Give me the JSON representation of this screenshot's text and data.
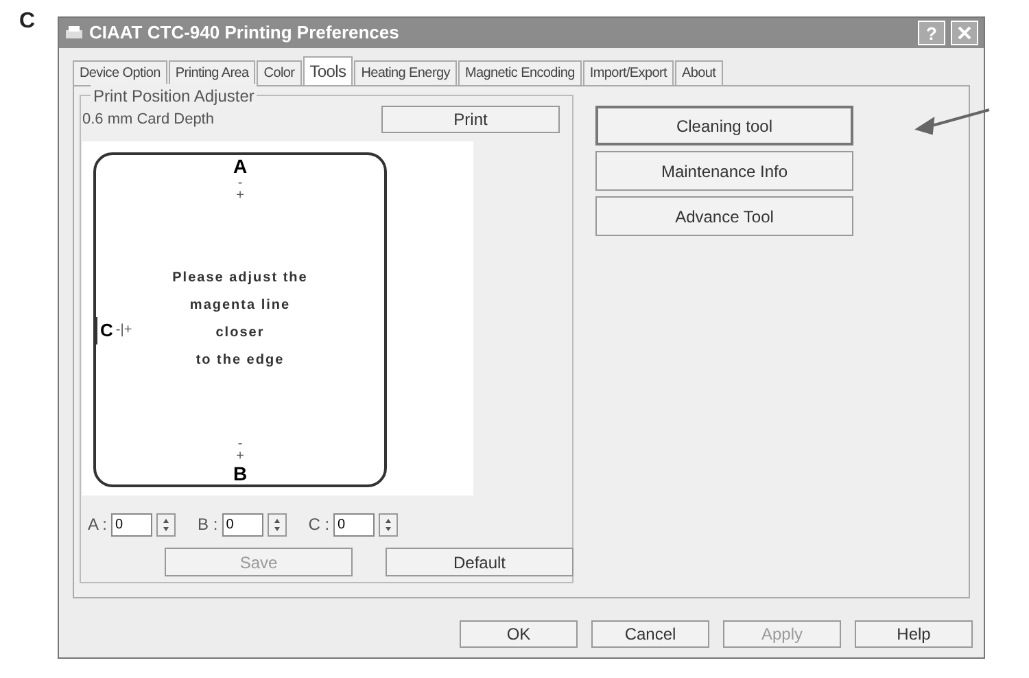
{
  "figure_label": "C",
  "window": {
    "title": "CIAAT CTC-940 Printing Preferences",
    "help_button": "?"
  },
  "tabs": [
    {
      "label": "Device Option",
      "selected": false
    },
    {
      "label": "Printing Area",
      "selected": false
    },
    {
      "label": "Color",
      "selected": false
    },
    {
      "label": "Tools",
      "selected": true
    },
    {
      "label": "Heating Energy",
      "selected": false
    },
    {
      "label": "Magnetic Encoding",
      "selected": false
    },
    {
      "label": "Import/Export",
      "selected": false
    },
    {
      "label": "About",
      "selected": false
    }
  ],
  "group": {
    "title": "Print Position Adjuster",
    "depth_label": "0.6 mm Card Depth",
    "print_button": "Print"
  },
  "card": {
    "top_label": "A",
    "top_marks": [
      "-",
      "+"
    ],
    "bottom_marks": [
      "-",
      "+"
    ],
    "bottom_label": "B",
    "side_label": "C",
    "side_marks": "-|+",
    "message": [
      "Please adjust the",
      "magenta line",
      "closer",
      "to the edge"
    ]
  },
  "spinners": [
    {
      "label": "A :",
      "value": "0"
    },
    {
      "label": "B :",
      "value": "0"
    },
    {
      "label": "C :",
      "value": "0"
    }
  ],
  "panel_buttons": [
    {
      "label": "Save",
      "disabled": true
    },
    {
      "label": "Default",
      "disabled": false
    }
  ],
  "tool_buttons": [
    {
      "label": "Cleaning tool",
      "focused": true
    },
    {
      "label": "Maintenance Info",
      "focused": false
    },
    {
      "label": "Advance Tool",
      "focused": false
    }
  ],
  "annotation": {
    "arrow": true
  },
  "footer_buttons": [
    {
      "label": "OK",
      "disabled": false
    },
    {
      "label": "Cancel",
      "disabled": false
    },
    {
      "label": "Apply",
      "disabled": true
    },
    {
      "label": "Help",
      "disabled": false
    }
  ]
}
